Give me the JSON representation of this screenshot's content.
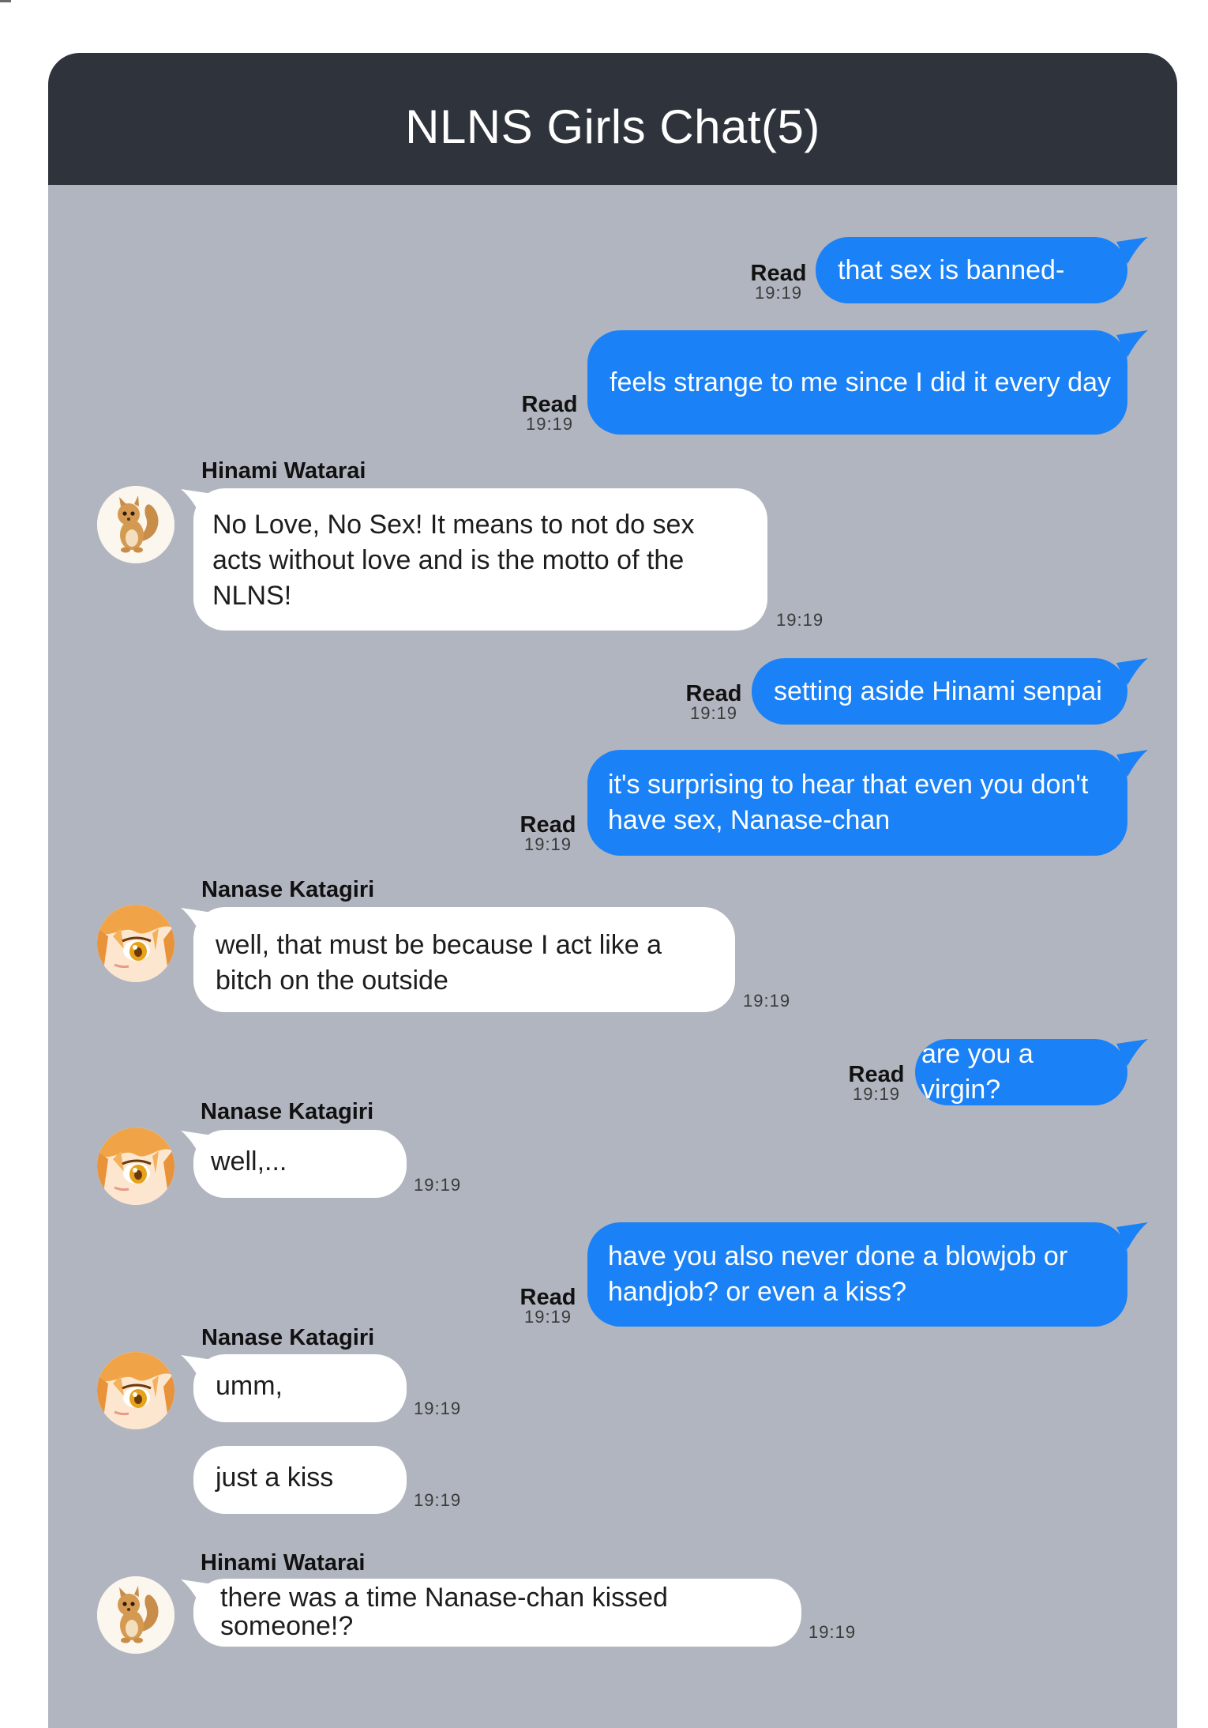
{
  "chat": {
    "title": "NLNS Girls Chat(5)",
    "read_label": "Read",
    "messages": [
      {
        "dir": "out",
        "text": "that sex is banned-",
        "time": "19:19"
      },
      {
        "dir": "out",
        "text": "feels strange to me since I did it every day",
        "time": "19:19"
      },
      {
        "dir": "in",
        "sender": "Hinami Watarai",
        "avatar": "squirrel-avatar-icon",
        "text": "No Love, No Sex! It means to not do sex acts without love and is the motto of the NLNS!",
        "time": "19:19"
      },
      {
        "dir": "out",
        "text": "setting aside Hinami senpai",
        "time": "19:19"
      },
      {
        "dir": "out",
        "text": "it's surprising to hear that even you don't have sex, Nanase-chan",
        "time": "19:19"
      },
      {
        "dir": "in",
        "sender": "Nanase Katagiri",
        "avatar": "anime-girl-avatar-icon",
        "text": "well, that must be because I act like a bitch on the outside",
        "time": "19:19"
      },
      {
        "dir": "out",
        "text": "are you a virgin?",
        "time": "19:19"
      },
      {
        "dir": "in",
        "sender": "Nanase Katagiri",
        "avatar": "anime-girl-avatar-icon",
        "text": "well,...",
        "time": "19:19"
      },
      {
        "dir": "out",
        "text": "have you also never done a blowjob or handjob? or even a kiss?",
        "time": "19:19"
      },
      {
        "dir": "in",
        "sender": "Nanase Katagiri",
        "avatar": "anime-girl-avatar-icon",
        "text": "umm,",
        "time": "19:19"
      },
      {
        "dir": "in",
        "text": "just a kiss",
        "time": "19:19"
      },
      {
        "dir": "in",
        "sender": "Hinami Watarai",
        "avatar": "squirrel-avatar-icon",
        "text": "there was a time Nanase-chan kissed someone!?",
        "time": "19:19"
      }
    ]
  },
  "colors": {
    "header_bg": "#2f333b",
    "chat_bg": "#b1b5bf",
    "outgoing_bubble": "#1a81f6",
    "incoming_bubble": "#ffffff"
  }
}
